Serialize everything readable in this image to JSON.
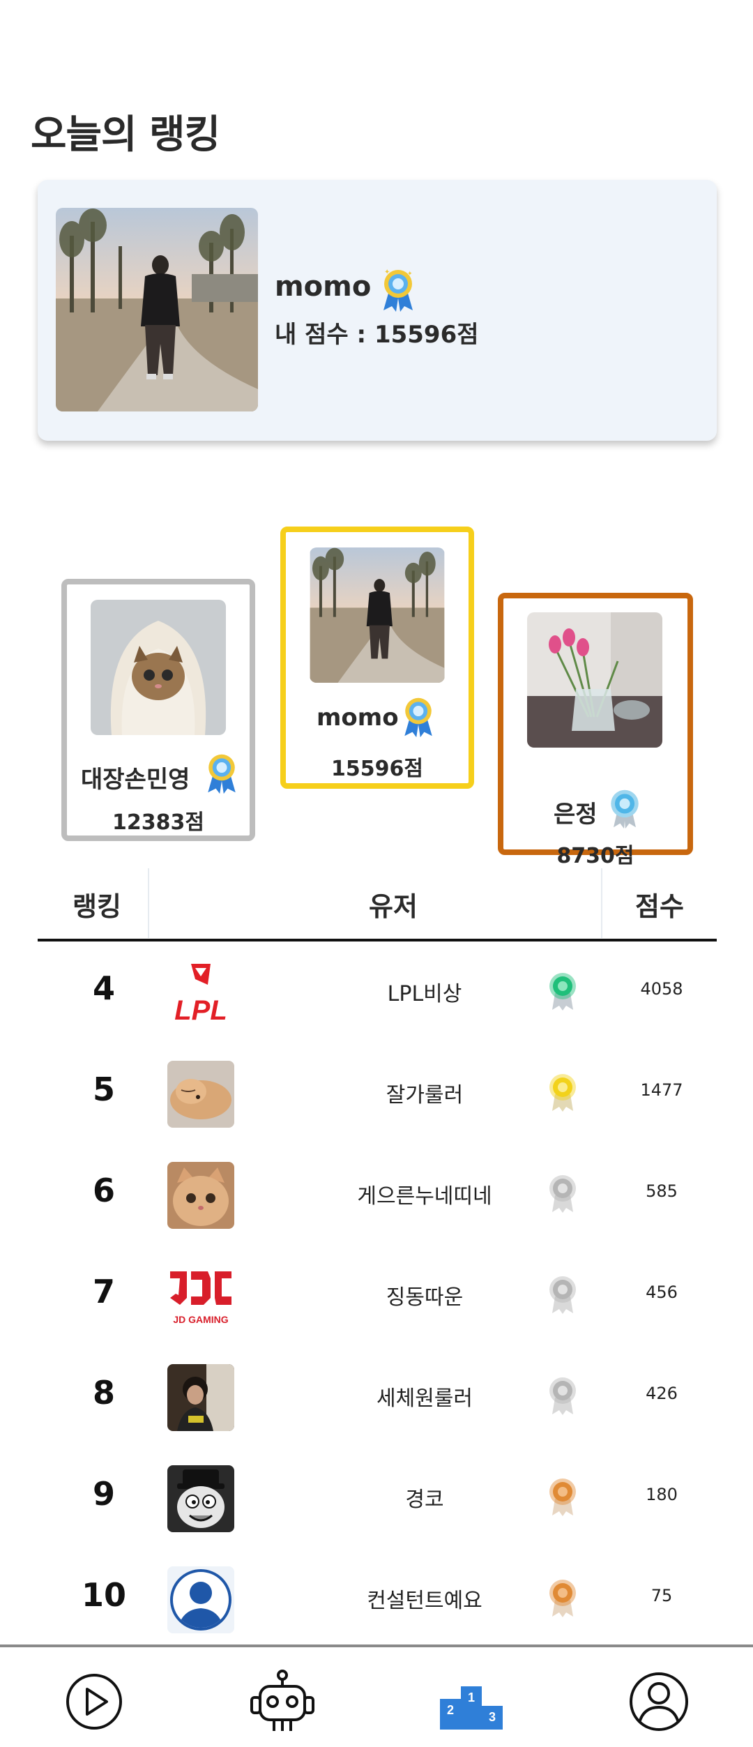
{
  "page": {
    "title": "오늘의 랭킹"
  },
  "my_card": {
    "name": "momo",
    "score": "내 점수 : 15596점",
    "badge_icon": "ribbon-medal-icon"
  },
  "podium": {
    "first": {
      "name": "momo",
      "score": "15596점",
      "badge_icon": "ribbon-medal-icon"
    },
    "second": {
      "name": "대장손민영",
      "score": "12383점",
      "badge_icon": "ribbon-medal-icon"
    },
    "third": {
      "name": "은정",
      "score": "8730점",
      "badge_icon": "diamond-medal-icon"
    }
  },
  "table": {
    "headers": {
      "rank": "랭킹",
      "user": "유저",
      "score": "점수"
    },
    "rows": [
      {
        "rank": "4",
        "name": "LPL비상",
        "score": "4058",
        "medal": "green-medal-icon",
        "medal_color": "#1fbf7a"
      },
      {
        "rank": "5",
        "name": "잘가룰러",
        "score": "1477",
        "medal": "gold-medal-icon",
        "medal_color": "#f2d21b"
      },
      {
        "rank": "6",
        "name": "게으른누네띠네",
        "score": "585",
        "medal": "silver-medal-icon",
        "medal_color": "#b5b5b5"
      },
      {
        "rank": "7",
        "name": "징동따운",
        "score": "456",
        "medal": "silver-medal-icon",
        "medal_color": "#b5b5b5"
      },
      {
        "rank": "8",
        "name": "세체원룰러",
        "score": "426",
        "medal": "silver-medal-icon",
        "medal_color": "#b5b5b5"
      },
      {
        "rank": "9",
        "name": "경코",
        "score": "180",
        "medal": "bronze-medal-icon",
        "medal_color": "#e08a35"
      },
      {
        "rank": "10",
        "name": "컨설턴트예요",
        "score": "75",
        "medal": "bronze-medal-icon",
        "medal_color": "#e08a35"
      }
    ]
  },
  "bottom_nav": {
    "items": [
      "play-icon",
      "robot-icon",
      "podium-icon",
      "profile-icon"
    ],
    "active": "podium-icon",
    "podium_digits": [
      "1",
      "2",
      "3"
    ]
  },
  "colors": {
    "accent": "#2f7fd8",
    "gold_border": "#f6cf1b",
    "silver_border": "#bdbdbd",
    "bronze_border": "#c8670e",
    "card_bg": "#eff4fa"
  }
}
